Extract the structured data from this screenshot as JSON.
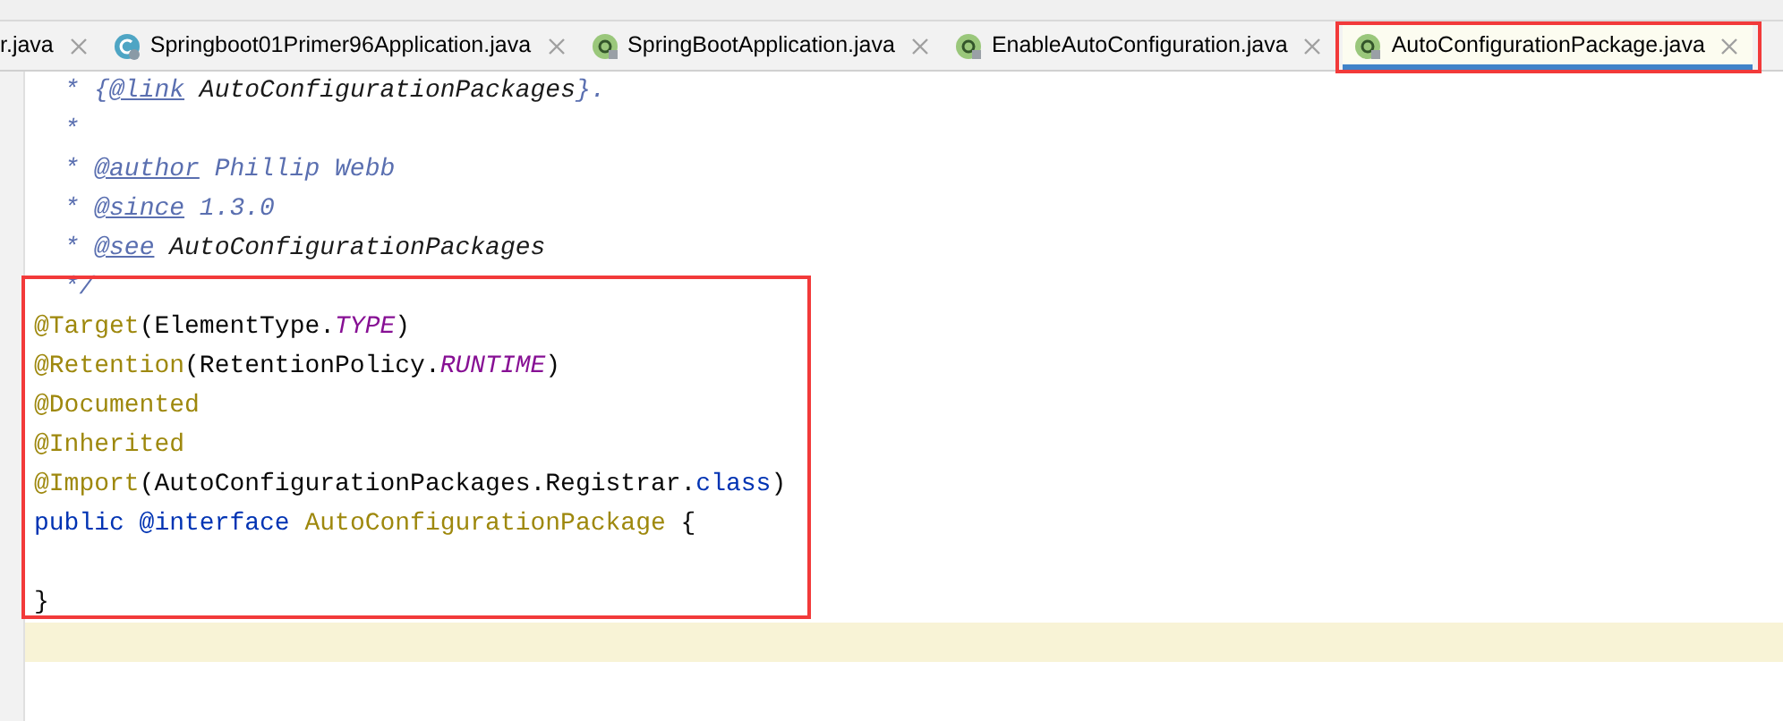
{
  "tabs": [
    {
      "label": "r.java",
      "kind": "plain",
      "selected": false
    },
    {
      "label": "Springboot01Primer96Application.java",
      "kind": "class",
      "selected": false
    },
    {
      "label": "SpringBootApplication.java",
      "kind": "annotation",
      "selected": false
    },
    {
      "label": "EnableAutoConfiguration.java",
      "kind": "annotation",
      "selected": false
    },
    {
      "label": "AutoConfigurationPackage.java",
      "kind": "annotation",
      "selected": true
    }
  ],
  "code_lines": [
    {
      "current": false,
      "tokens": [
        {
          "kind": "doc",
          "text": "  * {"
        },
        {
          "kind": "doctag",
          "text": "@link"
        },
        {
          "kind": "docref",
          "text": " AutoConfigurationPackages"
        },
        {
          "kind": "doc",
          "text": "}."
        }
      ]
    },
    {
      "current": false,
      "tokens": [
        {
          "kind": "doc",
          "text": "  *"
        }
      ]
    },
    {
      "current": false,
      "tokens": [
        {
          "kind": "doc",
          "text": "  * "
        },
        {
          "kind": "doctag",
          "text": "@author"
        },
        {
          "kind": "doc",
          "text": " Phillip Webb"
        }
      ]
    },
    {
      "current": false,
      "tokens": [
        {
          "kind": "doc",
          "text": "  * "
        },
        {
          "kind": "doctag",
          "text": "@since"
        },
        {
          "kind": "doc",
          "text": " 1.3.0"
        }
      ]
    },
    {
      "current": false,
      "tokens": [
        {
          "kind": "doc",
          "text": "  * "
        },
        {
          "kind": "doctag",
          "text": "@see"
        },
        {
          "kind": "docref",
          "text": " AutoConfigurationPackages"
        }
      ]
    },
    {
      "current": false,
      "tokens": [
        {
          "kind": "doc",
          "text": "  */"
        }
      ]
    },
    {
      "current": false,
      "tokens": [
        {
          "kind": "annotation",
          "text": "@Target"
        },
        {
          "kind": "plain",
          "text": "(ElementType."
        },
        {
          "kind": "constant",
          "text": "TYPE"
        },
        {
          "kind": "plain",
          "text": ")"
        }
      ]
    },
    {
      "current": false,
      "tokens": [
        {
          "kind": "annotation",
          "text": "@Retention"
        },
        {
          "kind": "plain",
          "text": "(RetentionPolicy."
        },
        {
          "kind": "constant",
          "text": "RUNTIME"
        },
        {
          "kind": "plain",
          "text": ")"
        }
      ]
    },
    {
      "current": false,
      "tokens": [
        {
          "kind": "annotation",
          "text": "@Documented"
        }
      ]
    },
    {
      "current": false,
      "tokens": [
        {
          "kind": "annotation",
          "text": "@Inherited"
        }
      ]
    },
    {
      "current": false,
      "tokens": [
        {
          "kind": "annotation",
          "text": "@Import"
        },
        {
          "kind": "plain",
          "text": "(AutoConfigurationPackages.Registrar."
        },
        {
          "kind": "keyword",
          "text": "class"
        },
        {
          "kind": "plain",
          "text": ")"
        }
      ]
    },
    {
      "current": false,
      "tokens": [
        {
          "kind": "keyword",
          "text": "public @interface "
        },
        {
          "kind": "annotation",
          "text": "AutoConfigurationPackage"
        },
        {
          "kind": "plain",
          "text": " {"
        }
      ]
    },
    {
      "current": false
    },
    {
      "current": false,
      "tokens": [
        {
          "kind": "plain",
          "text": "}"
        }
      ]
    },
    {
      "current": true
    }
  ]
}
